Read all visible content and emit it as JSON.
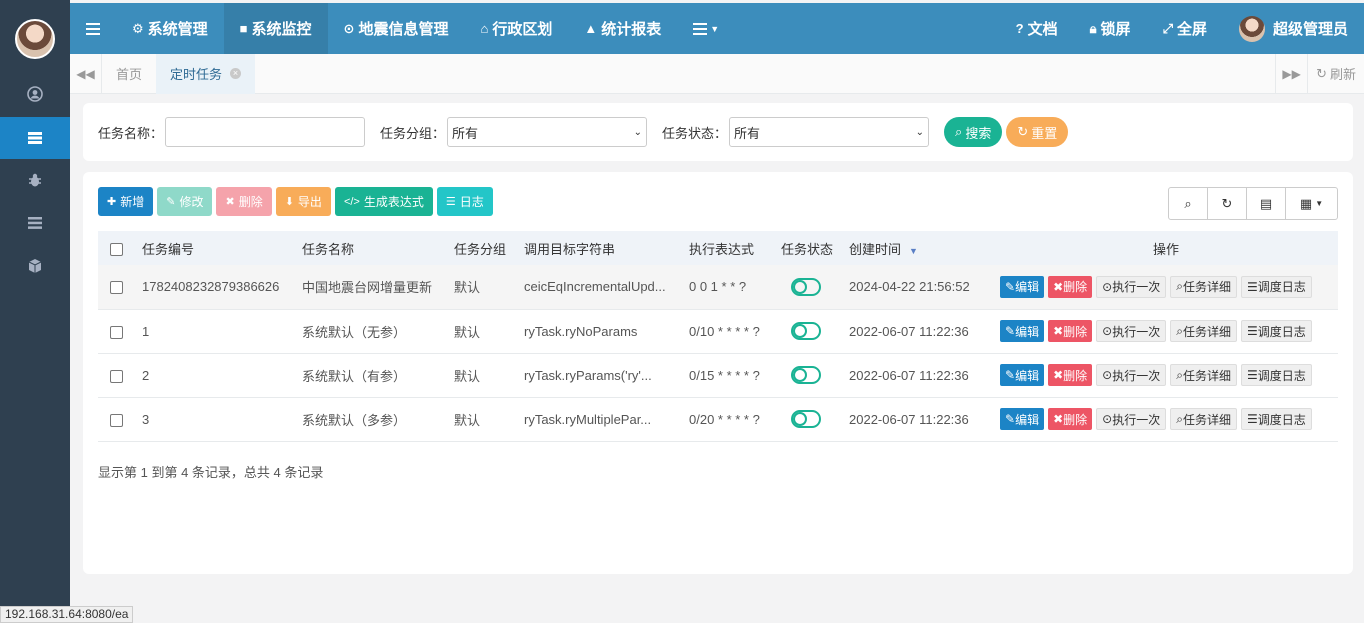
{
  "navbar": {
    "items": [
      {
        "icon": "menu-icon",
        "label": ""
      },
      {
        "icon": "gear-icon",
        "label": "系统管理"
      },
      {
        "icon": "video-icon",
        "label": "系统监控"
      },
      {
        "icon": "map-marker-icon",
        "label": "地震信息管理"
      },
      {
        "icon": "bank-icon",
        "label": "行政区划"
      },
      {
        "icon": "area-chart-icon",
        "label": "统计报表"
      },
      {
        "icon": "list-dropdown-icon",
        "label": ""
      }
    ],
    "right": {
      "docs": "文档",
      "lock": "锁屏",
      "fullscreen": "全屏",
      "user": "超级管理员"
    }
  },
  "tabs": {
    "home": "首页",
    "current": "定时任务",
    "refresh": "刷新"
  },
  "search": {
    "task_name_label": "任务名称：",
    "task_name_value": "",
    "task_group_label": "任务分组：",
    "task_group_value": "所有",
    "task_status_label": "任务状态：",
    "task_status_value": "所有",
    "search_btn": "搜索",
    "reset_btn": "重置"
  },
  "toolbar": {
    "add": "新增",
    "edit": "修改",
    "delete": "删除",
    "export": "导出",
    "gen_expr": "生成表达式",
    "log": "日志"
  },
  "table": {
    "headers": {
      "id": "任务编号",
      "name": "任务名称",
      "group": "任务分组",
      "target": "调用目标字符串",
      "cron": "执行表达式",
      "status": "任务状态",
      "created": "创建时间",
      "ops": "操作"
    },
    "rows": [
      {
        "id": "1782408232879386626",
        "name": "中国地震台网增量更新",
        "group": "默认",
        "target": "ceicEqIncrementalUpd...",
        "cron": "0 0 1 * * ?",
        "created": "2024-04-22 21:56:52"
      },
      {
        "id": "1",
        "name": "系统默认（无参）",
        "group": "默认",
        "target": "ryTask.ryNoParams",
        "cron": "0/10 * * * * ?",
        "created": "2022-06-07 11:22:36"
      },
      {
        "id": "2",
        "name": "系统默认（有参）",
        "group": "默认",
        "target": "ryTask.ryParams('ry'...",
        "cron": "0/15 * * * * ?",
        "created": "2022-06-07 11:22:36"
      },
      {
        "id": "3",
        "name": "系统默认（多参）",
        "group": "默认",
        "target": "ryTask.ryMultiplePar...",
        "cron": "0/20 * * * * ?",
        "created": "2022-06-07 11:22:36"
      }
    ],
    "row_ops": {
      "edit": "编辑",
      "delete": "删除",
      "run_once": "执行一次",
      "detail": "任务详细",
      "schedule_log": "调度日志"
    }
  },
  "pagination": {
    "info": "显示第 1 到第 4 条记录，总共 4 条记录"
  },
  "status_bar": {
    "url": "192.168.31.64:8080/ea"
  },
  "colors": {
    "sidebar_bg": "#2f4050",
    "navbar_bg": "#3c8dbc",
    "primary": "#1c84c6",
    "success": "#1ab394",
    "danger": "#ed5565",
    "warning": "#f8ac59",
    "info": "#23c6c8"
  }
}
